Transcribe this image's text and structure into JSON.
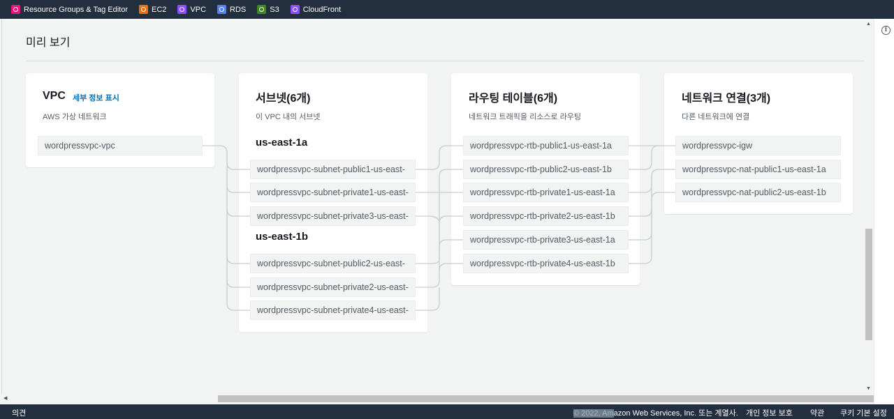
{
  "top_nav": {
    "favorites": [
      {
        "label": "Resource Groups & Tag Editor",
        "icon": "resource-groups-icon",
        "color": "#e7157b"
      },
      {
        "label": "EC2",
        "icon": "ec2-icon",
        "color": "#ed7100"
      },
      {
        "label": "VPC",
        "icon": "vpc-icon",
        "color": "#8c4fff"
      },
      {
        "label": "RDS",
        "icon": "rds-icon",
        "color": "#527fff"
      },
      {
        "label": "S3",
        "icon": "s3-icon",
        "color": "#3f8624"
      },
      {
        "label": "CloudFront",
        "icon": "cloudfront-icon",
        "color": "#8c4fff"
      }
    ]
  },
  "preview": {
    "title": "미리 보기",
    "vpc": {
      "title": "VPC",
      "details_link": "세부 정보 표시",
      "subtitle": "AWS 가상 네트워크",
      "items": [
        "wordpressvpc-vpc"
      ]
    },
    "subnets": {
      "title": "서브넷(6개)",
      "subtitle": "이 VPC 내의 서브넷",
      "zones": [
        {
          "name": "us-east-1a",
          "items": [
            "wordpressvpc-subnet-public1-us-east-",
            "wordpressvpc-subnet-private1-us-east-",
            "wordpressvpc-subnet-private3-us-east-"
          ]
        },
        {
          "name": "us-east-1b",
          "items": [
            "wordpressvpc-subnet-public2-us-east-",
            "wordpressvpc-subnet-private2-us-east-",
            "wordpressvpc-subnet-private4-us-east-"
          ]
        }
      ]
    },
    "route_tables": {
      "title": "라우팅 테이블(6개)",
      "subtitle": "네트워크 트래픽을 리소스로 라우팅",
      "items": [
        "wordpressvpc-rtb-public1-us-east-1a",
        "wordpressvpc-rtb-public2-us-east-1b",
        "wordpressvpc-rtb-private1-us-east-1a",
        "wordpressvpc-rtb-private2-us-east-1b",
        "wordpressvpc-rtb-private3-us-east-1a",
        "wordpressvpc-rtb-private4-us-east-1b"
      ]
    },
    "network_connections": {
      "title": "네트워크 연결(3개)",
      "subtitle": "다른 네트워크에 연결",
      "items": [
        "wordpressvpc-igw",
        "wordpressvpc-nat-public1-us-east-1a",
        "wordpressvpc-nat-public2-us-east-1b"
      ]
    }
  },
  "footer": {
    "feedback": "의견",
    "copyright_selected": "© 2022, Am",
    "copyright_rest": "azon Web Services, Inc. 또는 계열사.",
    "links": [
      "개인 정보 보호",
      "약관",
      "쿠키 기본 설정"
    ]
  },
  "colors": {
    "nav_bg": "#232f3e",
    "link": "#0073bb",
    "page_bg": "#f2f3f3"
  }
}
